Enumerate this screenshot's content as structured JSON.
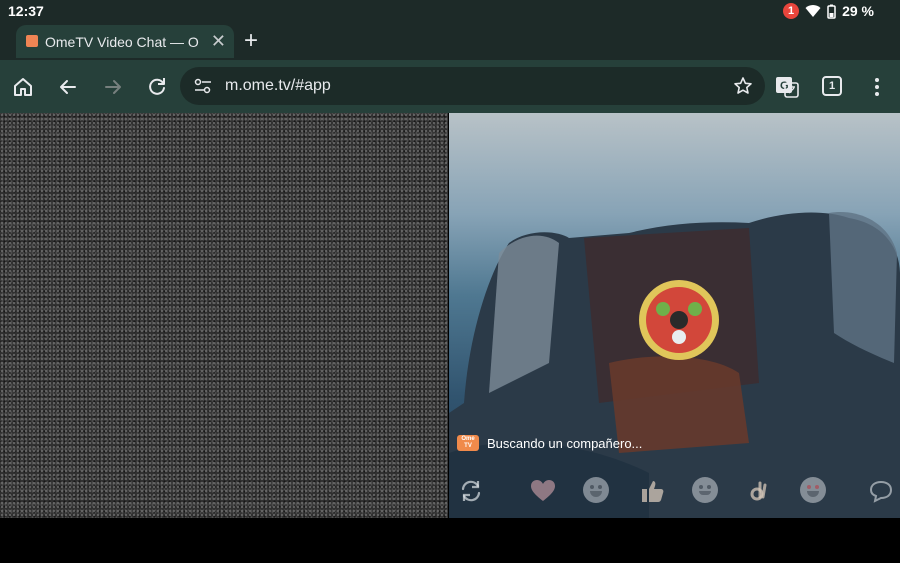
{
  "status_bar": {
    "time": "12:37",
    "notification_count": "1",
    "battery": "29 %"
  },
  "browser": {
    "tab": {
      "title": "OmeTV Video Chat — Omegle"
    },
    "url": "m.ome.tv/#app",
    "tab_count": "1"
  },
  "app": {
    "status_text": "Buscando un compañero...",
    "logo_text_line1": "Ome",
    "logo_text_line2": "TV"
  },
  "colors": {
    "accent": "#f08a4b",
    "toolbar": "#26403a",
    "tab_strip": "#1d2a28"
  }
}
